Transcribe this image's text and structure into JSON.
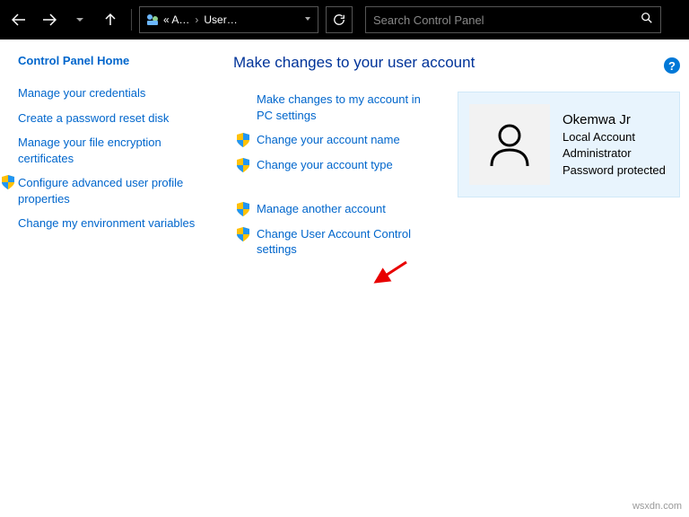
{
  "nav": {
    "back": "Back",
    "forward": "Forward",
    "up": "Up"
  },
  "breadcrumb": {
    "p1": "« A…",
    "p2": "User…"
  },
  "search": {
    "placeholder": "Search Control Panel"
  },
  "help": {
    "label": "?"
  },
  "sidebar": {
    "home": "Control Panel Home",
    "items": [
      "Manage your credentials",
      "Create a password reset disk",
      "Manage your file encryption certificates",
      "Configure advanced user profile properties",
      "Change my environment variables"
    ]
  },
  "page_title": "Make changes to your user account",
  "actions": {
    "a0": "Make changes to my account in PC settings",
    "a1": "Change your account name",
    "a2": "Change your account type",
    "a3": "Manage another account",
    "a4": "Change User Account Control settings"
  },
  "user": {
    "name": "Okemwa Jr",
    "type": "Local Account",
    "role": "Administrator",
    "pwd": "Password protected"
  },
  "watermark": "wsxdn.com"
}
